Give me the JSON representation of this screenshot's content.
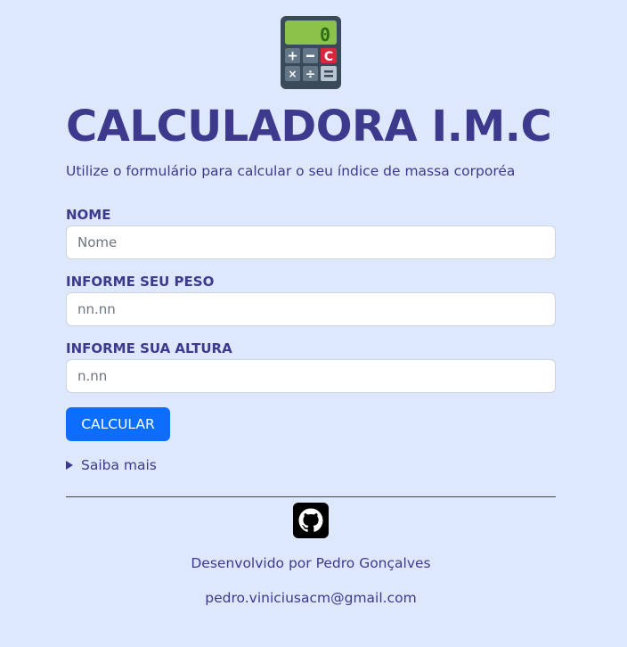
{
  "header": {
    "logo_icon": "calculator-icon",
    "title": "CALCULADORA I.M.C",
    "subtitle": "Utilize o formulário para calcular o seu índice de massa corporéa"
  },
  "form": {
    "name": {
      "label": "NOME",
      "placeholder": "Nome",
      "value": ""
    },
    "weight": {
      "label": "INFORME SEU PESO",
      "placeholder": "nn.nn",
      "value": ""
    },
    "height": {
      "label": "INFORME SUA ALTURA",
      "placeholder": "n.nn",
      "value": ""
    },
    "submit_label": "CALCULAR"
  },
  "details": {
    "summary": "Saiba mais",
    "expanded": false
  },
  "footer": {
    "icon": "github-icon",
    "credit": "Desenvolvido por Pedro Gonçalves",
    "email": "pedro.viniciusacm@gmail.com"
  },
  "colors": {
    "background": "#dde8fc",
    "primary_text": "#3d3a8e",
    "button": "#0d6efd",
    "calculator_display": "#8bc34a"
  }
}
